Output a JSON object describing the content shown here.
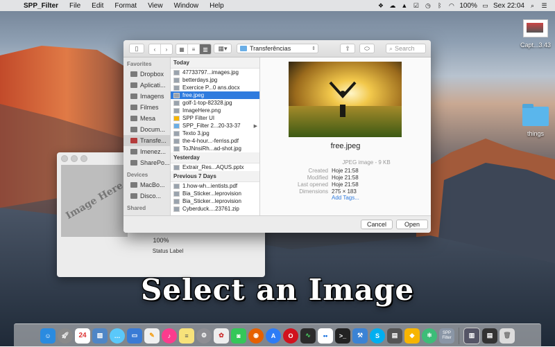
{
  "menubar": {
    "app_name": "SPP_Filter",
    "items": [
      "File",
      "Edit",
      "Format",
      "View",
      "Window",
      "Help"
    ],
    "battery": "100%",
    "clock": "Sex 22:04",
    "status_icons": [
      "dropbox-icon",
      "cloud-icon",
      "drive-icon",
      "checkbox-icon",
      "clock-icon",
      "bluetooth-icon",
      "wifi-icon",
      "battery-icon"
    ]
  },
  "desktop": {
    "icons": [
      {
        "label": "Capt...3.43",
        "type": "screenshot-thumbnail"
      },
      {
        "label": "things",
        "type": "folder"
      }
    ]
  },
  "app_window": {
    "image_placeholder": "Image Here",
    "progress": "100%",
    "status_label": "Status Label"
  },
  "caption": "Select an Image",
  "dialog": {
    "location": "Transferências",
    "search_placeholder": "Search",
    "sidebar": {
      "favorites_header": "Favorites",
      "favorites": [
        {
          "label": "Dropbox",
          "icon": "dropbox-icon"
        },
        {
          "label": "Aplicati...",
          "icon": "applications-icon"
        },
        {
          "label": "Imagens",
          "icon": "pictures-icon"
        },
        {
          "label": "Filmes",
          "icon": "movies-icon"
        },
        {
          "label": "Mesa",
          "icon": "desktop-icon"
        },
        {
          "label": "Docum...",
          "icon": "documents-icon"
        },
        {
          "label": "Transfe...",
          "icon": "downloads-icon",
          "selected": true
        },
        {
          "label": "Imenez...",
          "icon": "home-icon"
        },
        {
          "label": "SharePo...",
          "icon": "folder-icon"
        }
      ],
      "devices_header": "Devices",
      "devices": [
        {
          "label": "MacBo...",
          "icon": "laptop-icon"
        },
        {
          "label": "Disco...",
          "icon": "disk-icon"
        }
      ],
      "shared_header": "Shared"
    },
    "files": {
      "today_header": "Today",
      "today": [
        {
          "name": "47733797...images.jpg"
        },
        {
          "name": "betterdays.jpg"
        },
        {
          "name": "Exercice P...0 ans.docx"
        },
        {
          "name": "free.jpeg",
          "selected": true
        },
        {
          "name": "golf-1-top-82328.jpg"
        },
        {
          "name": "ImageHere.png"
        },
        {
          "name": "SPP Filter UI"
        },
        {
          "name": "SPP_Filter 2...20-33-37",
          "folder": true
        },
        {
          "name": "Texto 3.jpg"
        },
        {
          "name": "the-4-hour...-ferriss.pdf"
        },
        {
          "name": "ToJNnsiRh...ad-shot.jpg"
        }
      ],
      "yesterday_header": "Yesterday",
      "yesterday": [
        {
          "name": "Extrair_Res...AQUS.pptx"
        }
      ],
      "week_header": "Previous 7 Days",
      "week": [
        {
          "name": "1.how-wh...ientists.pdf"
        },
        {
          "name": "Bia_Sticker...leprovision"
        },
        {
          "name": "Bia_Sticker...leprovision"
        },
        {
          "name": "Cyberduck....23761.zip"
        }
      ]
    },
    "preview": {
      "file_name": "free.jpeg",
      "kind": "JPEG image - 9 KB",
      "created_label": "Created",
      "created": "Hoje 21:58",
      "modified_label": "Modified",
      "modified": "Hoje 21:58",
      "opened_label": "Last opened",
      "opened": "Hoje 21:58",
      "dimensions_label": "Dimensions",
      "dimensions": "275 × 183",
      "add_tags": "Add Tags..."
    },
    "cancel_label": "Cancel",
    "open_label": "Open"
  },
  "dock": {
    "calendar_day": "24",
    "filter_app_label": "SPP Filter",
    "apps": [
      {
        "name": "finder-icon",
        "color": "#2a8be0"
      },
      {
        "name": "launchpad-icon",
        "color": "#8a8a8a"
      },
      {
        "name": "calendar-icon",
        "color": "#ffffff"
      },
      {
        "name": "preview-icon",
        "color": "#4f86c6"
      },
      {
        "name": "messages-icon",
        "color": "#5ac8fa"
      },
      {
        "name": "keynote-icon",
        "color": "#3a7bd5"
      },
      {
        "name": "pages-icon",
        "color": "#f0f0f0"
      },
      {
        "name": "itunes-icon",
        "color": "#fc3c8d"
      },
      {
        "name": "notes-icon",
        "color": "#f7e27a"
      },
      {
        "name": "system-preferences-icon",
        "color": "#8e8e93"
      },
      {
        "name": "photos-icon",
        "color": "#eee"
      },
      {
        "name": "facetime-icon",
        "color": "#34c759"
      },
      {
        "name": "firefox-icon",
        "color": "#e66000"
      },
      {
        "name": "app-store-icon",
        "color": "#2d7cf6"
      },
      {
        "name": "opera-icon",
        "color": "#d1121e"
      },
      {
        "name": "activity-monitor-icon",
        "color": "#2b2b2b"
      },
      {
        "name": "flickr-icon",
        "color": "#ffffff"
      },
      {
        "name": "terminal-icon",
        "color": "#222222"
      },
      {
        "name": "xcode-icon",
        "color": "#3b83d4"
      },
      {
        "name": "skype-icon",
        "color": "#00aff0"
      },
      {
        "name": "console-icon",
        "color": "#555555"
      },
      {
        "name": "sketch-icon",
        "color": "#f7b500"
      },
      {
        "name": "atom-icon",
        "color": "#3dbd78"
      }
    ]
  }
}
